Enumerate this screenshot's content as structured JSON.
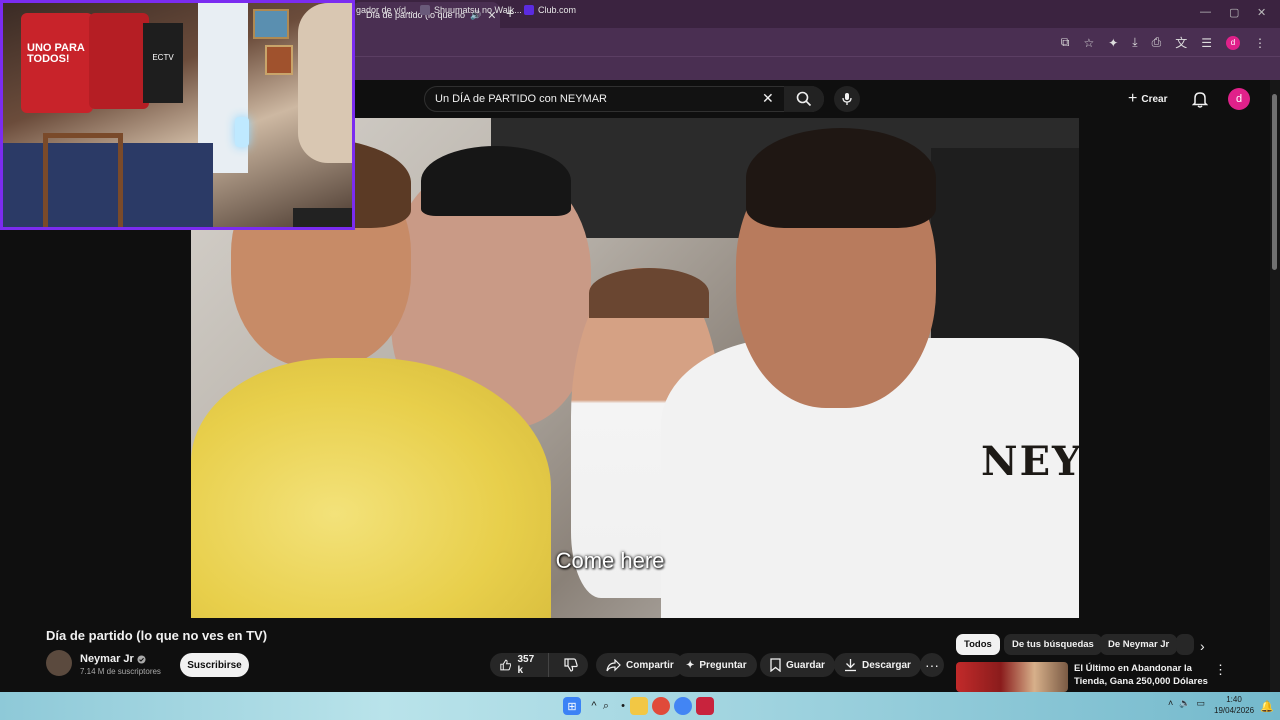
{
  "browser": {
    "tab_title": "Día de partido (lo que no ves en TV)",
    "new_tab": "+",
    "window_controls": [
      "—",
      "▢",
      "✕"
    ],
    "bookmarks": [
      {
        "label": "gador de víd...",
        "color": "#7b2cf0"
      },
      {
        "label": "Shuumatsu no Walk...",
        "color": "#6a5a7a"
      },
      {
        "label": "Club.com",
        "color": "#5b2be0"
      }
    ],
    "profile_initial": "d"
  },
  "youtube": {
    "search_value": "Un DÍA de PARTIDO con NEYMAR",
    "create_label": "Crear",
    "avatar_initial": "d"
  },
  "video": {
    "subtitle": "Come here",
    "shirt_text": "NEY"
  },
  "webcam": {
    "shirt_text": "UNO PARA TODOS!",
    "shirt3_text": "ECTV"
  },
  "info": {
    "title": "Día de partido (lo que no ves en TV)",
    "channel_name": "Neymar Jr",
    "verified_icon": "verified-icon",
    "subscribers": "7.14 M de suscriptores",
    "subscribe_label": "Suscribirse",
    "likes": "357 k",
    "share_label": "Compartir",
    "ask_label": "Preguntar",
    "save_label": "Guardar",
    "download_label": "Descargar",
    "more_label": "···"
  },
  "related": {
    "chips": [
      "Todos",
      "De tus búsquedas",
      "De Neymar Jr"
    ],
    "active_chip": "Todos",
    "first_title": "El Último en Abandonar la Tienda, Gana 250,000 Dólares"
  },
  "taskbar": {
    "time": "1:40",
    "date": "19/04/2026"
  },
  "colors": {
    "brand_pink": "#e0218a",
    "webcam_border": "#7b2cf0",
    "yt_background": "#0f0f0f"
  }
}
